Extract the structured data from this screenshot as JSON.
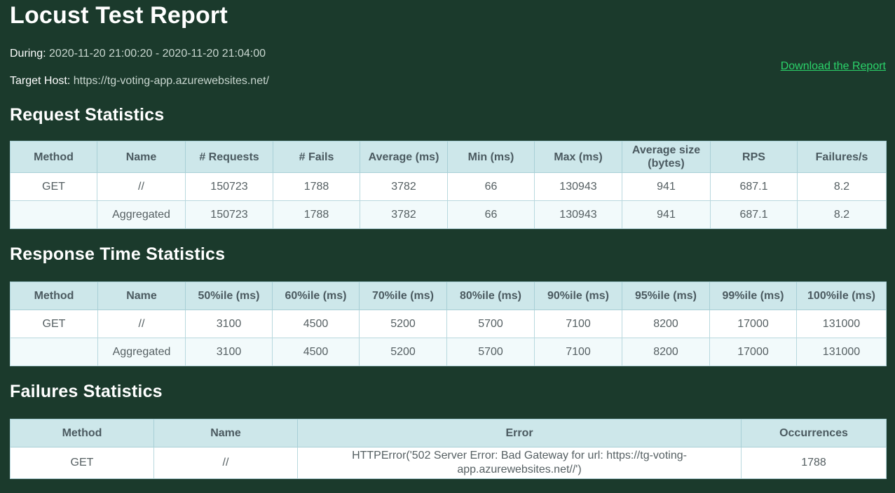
{
  "title": "Locust Test Report",
  "during": {
    "label": "During:",
    "value": "2020-11-20 21:00:20 - 2020-11-20 21:04:00"
  },
  "target_host": {
    "label": "Target Host:",
    "value": "https://tg-voting-app.azurewebsites.net/"
  },
  "download_link": "Download the Report",
  "request_statistics": {
    "heading": "Request Statistics",
    "columns": [
      "Method",
      "Name",
      "# Requests",
      "# Fails",
      "Average (ms)",
      "Min (ms)",
      "Max (ms)",
      "Average size (bytes)",
      "RPS",
      "Failures/s"
    ],
    "rows": [
      [
        "GET",
        "//",
        "150723",
        "1788",
        "3782",
        "66",
        "130943",
        "941",
        "687.1",
        "8.2"
      ],
      [
        "",
        "Aggregated",
        "150723",
        "1788",
        "3782",
        "66",
        "130943",
        "941",
        "687.1",
        "8.2"
      ]
    ]
  },
  "response_time_statistics": {
    "heading": "Response Time Statistics",
    "columns": [
      "Method",
      "Name",
      "50%ile (ms)",
      "60%ile (ms)",
      "70%ile (ms)",
      "80%ile (ms)",
      "90%ile (ms)",
      "95%ile (ms)",
      "99%ile (ms)",
      "100%ile (ms)"
    ],
    "rows": [
      [
        "GET",
        "//",
        "3100",
        "4500",
        "5200",
        "5700",
        "7100",
        "8200",
        "17000",
        "131000"
      ],
      [
        "",
        "Aggregated",
        "3100",
        "4500",
        "5200",
        "5700",
        "7100",
        "8200",
        "17000",
        "131000"
      ]
    ]
  },
  "failures_statistics": {
    "heading": "Failures Statistics",
    "columns": [
      "Method",
      "Name",
      "Error",
      "Occurrences"
    ],
    "rows": [
      [
        "GET",
        "//",
        "HTTPError('502 Server Error: Bad Gateway for url: https://tg-voting-app.azurewebsites.net//')",
        "1788"
      ]
    ]
  }
}
